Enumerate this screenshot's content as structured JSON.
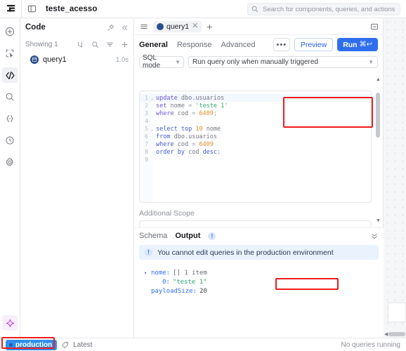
{
  "topbar": {
    "app_title": "teste_acesso",
    "logo_icon": "retool-logo-icon",
    "panel_toggle_icon": "panel-toggle-icon",
    "search": {
      "icon": "search-icon",
      "placeholder": "Search for components, queries, and actions",
      "value": ""
    }
  },
  "left_rail": {
    "items": [
      {
        "icon": "plus-circle-icon",
        "name": "add-component",
        "active": false
      },
      {
        "icon": "select-cursor-icon",
        "name": "select-tool",
        "active": false
      },
      {
        "icon": "code-brackets-icon",
        "name": "code",
        "active": true
      },
      {
        "icon": "search-icon",
        "name": "search",
        "active": false
      },
      {
        "icon": "curly-braces-icon",
        "name": "state",
        "active": false
      },
      {
        "icon": "history-clock-icon",
        "name": "history",
        "active": false
      },
      {
        "icon": "gear-icon",
        "name": "settings",
        "active": false
      }
    ],
    "ai_icon": "ai-sparkle-icon"
  },
  "code_panel": {
    "title": "Code",
    "pin_icon": "pin-icon",
    "collapse_icon": "chevrons-left-icon",
    "showing_label": "Showing 1",
    "toolbar_icons": [
      "sort-icon",
      "search-icon",
      "filter-icon",
      "plus-icon"
    ],
    "items": [
      {
        "label": "query1",
        "duration": "1.0s",
        "icon": "sql-database-icon"
      }
    ]
  },
  "editor": {
    "hamburger_icon": "hamburger-icon",
    "collapse_icon": "collapse-panel-icon",
    "tab": {
      "label": "query1",
      "icon": "sql-database-icon",
      "close_icon": "close-icon"
    },
    "new_tab_icon": "plus-icon",
    "subtabs": [
      {
        "label": "General",
        "active": true
      },
      {
        "label": "Response",
        "active": false
      },
      {
        "label": "Advanced",
        "active": false
      }
    ],
    "actions": {
      "more_label": "•••",
      "preview_label": "Preview",
      "run_label": "Run",
      "run_shortcut": "⌘↩"
    },
    "mode_select": {
      "value": "SQL mode",
      "chevron_icon": "chevron-down-icon"
    },
    "trigger_select": {
      "value": "Run query only when manually triggered",
      "chevron_icon": "chevron-down-icon"
    },
    "code_lines": [
      {
        "n": "1",
        "fold": "⌄",
        "highlight": true,
        "tokens": [
          {
            "t": "update",
            "c": "k"
          },
          {
            "t": " ",
            "c": "op"
          },
          {
            "t": "dbo.usuarios",
            "c": "id"
          }
        ]
      },
      {
        "n": "2",
        "fold": "",
        "highlight": false,
        "tokens": [
          {
            "t": "set",
            "c": "k"
          },
          {
            "t": " ",
            "c": "op"
          },
          {
            "t": "nome",
            "c": "id"
          },
          {
            "t": " = ",
            "c": "op"
          },
          {
            "t": "'teste 1'",
            "c": "str"
          }
        ]
      },
      {
        "n": "3",
        "fold": "",
        "highlight": false,
        "tokens": [
          {
            "t": "where",
            "c": "k"
          },
          {
            "t": " ",
            "c": "op"
          },
          {
            "t": "cod",
            "c": "id"
          },
          {
            "t": " = ",
            "c": "op"
          },
          {
            "t": "6409",
            "c": "num"
          },
          {
            "t": ";",
            "c": "op"
          }
        ]
      },
      {
        "n": "4",
        "fold": "",
        "highlight": false,
        "tokens": []
      },
      {
        "n": "5",
        "fold": "⌄",
        "highlight": false,
        "tokens": [
          {
            "t": "select",
            "c": "kb"
          },
          {
            "t": " ",
            "c": "op"
          },
          {
            "t": "top",
            "c": "kb"
          },
          {
            "t": " ",
            "c": "op"
          },
          {
            "t": "10",
            "c": "num"
          },
          {
            "t": " ",
            "c": "op"
          },
          {
            "t": "nome",
            "c": "id"
          }
        ]
      },
      {
        "n": "6",
        "fold": "",
        "highlight": false,
        "tokens": [
          {
            "t": "from",
            "c": "kb"
          },
          {
            "t": " ",
            "c": "op"
          },
          {
            "t": "dbo.usuarios",
            "c": "id"
          }
        ]
      },
      {
        "n": "7",
        "fold": "",
        "highlight": false,
        "tokens": [
          {
            "t": "where",
            "c": "kb"
          },
          {
            "t": " ",
            "c": "op"
          },
          {
            "t": "cod",
            "c": "id"
          },
          {
            "t": " = ",
            "c": "op"
          },
          {
            "t": "6409",
            "c": "num"
          }
        ]
      },
      {
        "n": "8",
        "fold": "",
        "highlight": false,
        "tokens": [
          {
            "t": "order by",
            "c": "kb"
          },
          {
            "t": " ",
            "c": "op"
          },
          {
            "t": "cod",
            "c": "id"
          },
          {
            "t": " ",
            "c": "op"
          },
          {
            "t": "desc",
            "c": "kb"
          },
          {
            "t": ";",
            "c": "op"
          }
        ]
      },
      {
        "n": "9",
        "fold": "",
        "highlight": false,
        "tokens": []
      }
    ],
    "additional_scope_label": "Additional Scope"
  },
  "result": {
    "tabs": [
      {
        "label": "Schema",
        "active": false,
        "badge": ""
      },
      {
        "label": "Output",
        "active": true,
        "badge": "!"
      }
    ],
    "expand_icon": "chevrons-down-icon",
    "banner": {
      "icon": "info-icon",
      "text": "You cannot edit queries in the production environment"
    },
    "json": [
      {
        "indent": 0,
        "caret": "▾",
        "key": "nome:",
        "meta": "[]  1 item",
        "value": "",
        "value_type": ""
      },
      {
        "indent": 1,
        "caret": "",
        "key": "0:",
        "meta": "",
        "value": "\"teste 1\"",
        "value_type": "string"
      },
      {
        "indent": 0,
        "caret": "",
        "key": "payloadSize:",
        "meta": "",
        "value": "20",
        "value_type": "number"
      }
    ]
  },
  "statusbar": {
    "environment": "production",
    "tag_icon": "tag-icon",
    "version_label": "Latest",
    "queries_status": "No queries running"
  },
  "colors": {
    "accent_blue": "#2f6fed",
    "env_blue": "#2f8fed",
    "annotation_red": "#ef1c1c",
    "string_green": "#2ea86b",
    "number_orange": "#e08b2c",
    "keyword_purple": "#6f56d8"
  }
}
